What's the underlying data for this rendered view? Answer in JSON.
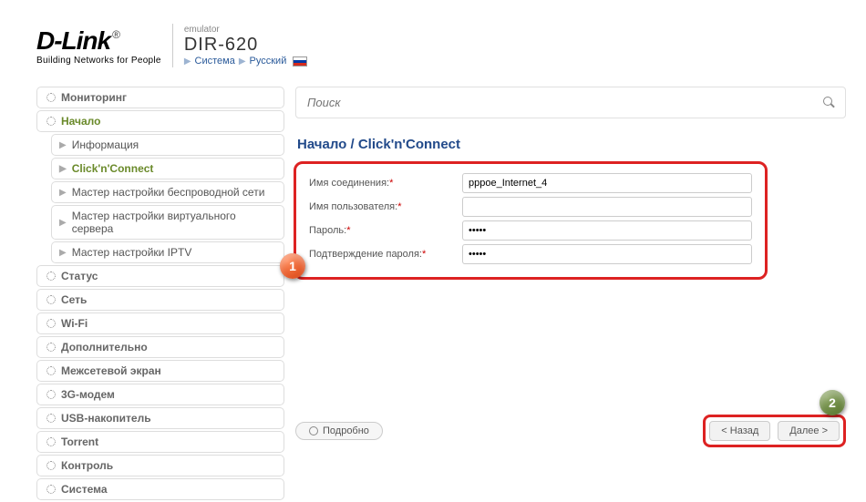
{
  "header": {
    "brand": "D-Link",
    "reg": "®",
    "tagline": "Building Networks for People",
    "emulator": "emulator",
    "model": "DIR-620",
    "link_system": "Система",
    "link_lang": "Русский"
  },
  "sidebar": {
    "items": [
      {
        "label": "Мониторинг",
        "type": "top"
      },
      {
        "label": "Начало",
        "type": "top",
        "expanded": true
      },
      {
        "label": "Информация",
        "type": "sub"
      },
      {
        "label": "Click'n'Connect",
        "type": "sub",
        "active": true
      },
      {
        "label": "Мастер настройки беспроводной сети",
        "type": "sub"
      },
      {
        "label": "Мастер настройки виртуального сервера",
        "type": "sub"
      },
      {
        "label": "Мастер настройки IPTV",
        "type": "sub"
      },
      {
        "label": "Статус",
        "type": "top"
      },
      {
        "label": "Сеть",
        "type": "top"
      },
      {
        "label": "Wi-Fi",
        "type": "top"
      },
      {
        "label": "Дополнительно",
        "type": "top"
      },
      {
        "label": "Межсетевой экран",
        "type": "top"
      },
      {
        "label": "3G-модем",
        "type": "top"
      },
      {
        "label": "USB-накопитель",
        "type": "top"
      },
      {
        "label": "Torrent",
        "type": "top"
      },
      {
        "label": "Контроль",
        "type": "top"
      },
      {
        "label": "Система",
        "type": "top"
      }
    ]
  },
  "search": {
    "placeholder": "Поиск"
  },
  "breadcrumb": {
    "path": "Начало /  Click'n'Connect"
  },
  "form": {
    "conn_name_label": "Имя соединения:",
    "conn_name_value": "pppoe_Internet_4",
    "user_label": "Имя пользователя:",
    "user_value": "",
    "pass_label": "Пароль:",
    "pass_value": "•••••",
    "pass2_label": "Подтверждение пароля:",
    "pass2_value": "•••••"
  },
  "callouts": {
    "one": "1",
    "two": "2"
  },
  "buttons": {
    "details": "Подробно",
    "back": "< Назад",
    "next": "Далее >"
  }
}
